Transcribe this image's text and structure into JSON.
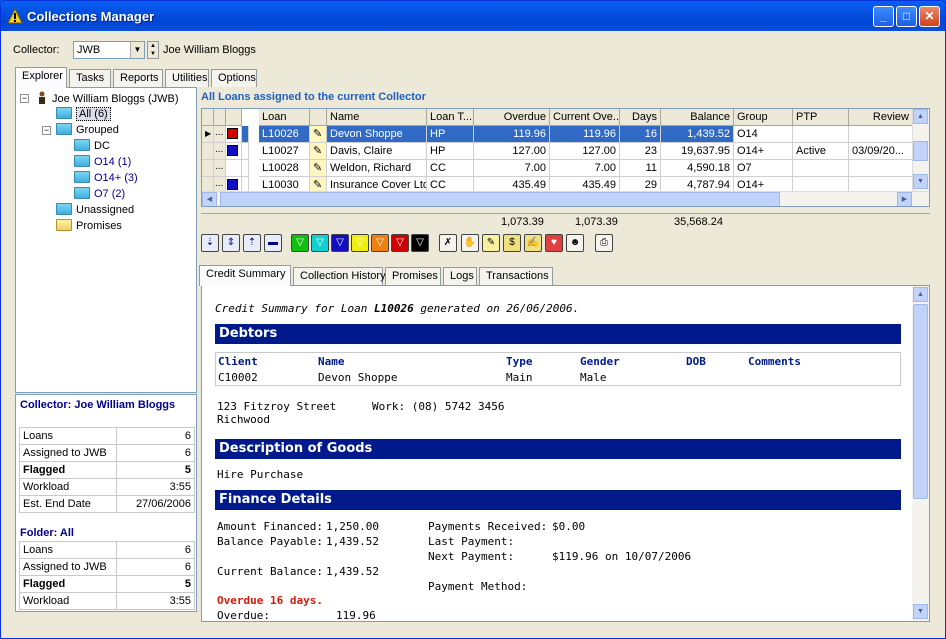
{
  "window": {
    "title": "Collections Manager"
  },
  "collector": {
    "label": "Collector:",
    "code": "JWB",
    "name": "Joe William Bloggs"
  },
  "main_tabs": [
    "Explorer",
    "Tasks",
    "Reports",
    "Utilities",
    "Options"
  ],
  "tree": {
    "root": "Joe William Bloggs (JWB)",
    "all": "All (6)",
    "grouped": "Grouped",
    "groups": [
      "DC",
      "O14 (1)",
      "O14+ (3)",
      "O7 (2)"
    ],
    "unassigned": "Unassigned",
    "promises": "Promises"
  },
  "stats": {
    "collector_title": "Collector: Joe William Bloggs",
    "collector_rows": [
      {
        "label": "Loans",
        "value": "6",
        "bold": false
      },
      {
        "label": "Assigned to JWB",
        "value": "6",
        "bold": false
      },
      {
        "label": "Flagged",
        "value": "5",
        "bold": true
      },
      {
        "label": "Workload",
        "value": "3:55",
        "bold": false
      },
      {
        "label": "Est. End Date",
        "value": "27/06/2006",
        "bold": false
      }
    ],
    "folder_title": "Folder: All",
    "folder_rows": [
      {
        "label": "Loans",
        "value": "6",
        "bold": false
      },
      {
        "label": "Assigned to JWB",
        "value": "6",
        "bold": false
      },
      {
        "label": "Flagged",
        "value": "5",
        "bold": true
      },
      {
        "label": "Workload",
        "value": "3:55",
        "bold": false
      }
    ]
  },
  "grid": {
    "title": "All Loans assigned to the current Collector",
    "columns": [
      "Loan",
      "Name",
      "Loan T...",
      "Overdue",
      "Current Ove...",
      "Days",
      "Balance",
      "Group",
      "PTP",
      "Review"
    ],
    "rows": [
      {
        "loan": "L10026",
        "name": "Devon Shoppe",
        "type": "HP",
        "overdue": "119.96",
        "current": "119.96",
        "days": "16",
        "balance": "1,439.52",
        "group": "O14",
        "ptp": "",
        "review": "",
        "flag": "#d00000",
        "selected": true
      },
      {
        "loan": "L10027",
        "name": "Davis, Claire",
        "type": "HP",
        "overdue": "127.00",
        "current": "127.00",
        "days": "23",
        "balance": "19,637.95",
        "group": "O14+",
        "ptp": "Active",
        "review": "03/09/20...",
        "flag": "#1010c0",
        "selected": false
      },
      {
        "loan": "L10028",
        "name": "Weldon, Richard",
        "type": "CC",
        "overdue": "7.00",
        "current": "7.00",
        "days": "11",
        "balance": "4,590.18",
        "group": "O7",
        "ptp": "",
        "review": "",
        "flag": "",
        "selected": false
      },
      {
        "loan": "L10030",
        "name": "Insurance Cover Ltd",
        "type": "CC",
        "overdue": "435.49",
        "current": "435.49",
        "days": "29",
        "balance": "4,787.94",
        "group": "O14+",
        "ptp": "",
        "review": "",
        "flag": "#1010c0",
        "selected": false
      }
    ],
    "row_marker": "...",
    "totals": {
      "overdue": "1,073.39",
      "current": "1,073.39",
      "balance": "35,568.24"
    }
  },
  "toolbar_flags": [
    "#10c010",
    "#10d0d0",
    "#1010c0",
    "#f0f010",
    "#f08010",
    "#d00000",
    "#000000"
  ],
  "detail_tabs": [
    "Credit Summary",
    "Collection History",
    "Promises",
    "Logs",
    "Transactions"
  ],
  "summary": {
    "intro_pre": "Credit Summary for Loan ",
    "intro_loan": "L10026",
    "intro_post": " generated on 26/06/2006.",
    "debtors_head": "Debtors",
    "debtor_cols": [
      "Client",
      "Name",
      "Type",
      "Gender",
      "DOB",
      "Comments"
    ],
    "debtor_row": [
      "C10002",
      "Devon Shoppe",
      "Main",
      "Male",
      "",
      ""
    ],
    "address1": "123 Fitzroy Street",
    "address2": "Richwood",
    "work": "Work: (08) 5742 3456",
    "goods_head": "Description of Goods",
    "goods": "Hire Purchase",
    "finance_head": "Finance Details",
    "amount_financed_label": "Amount Financed:",
    "amount_financed": "1,250.00",
    "balance_payable_label": "Balance Payable:",
    "balance_payable": "1,439.52",
    "current_balance_label": "Current Balance:",
    "current_balance": "1,439.52",
    "payments_received_label": "Payments Received:",
    "payments_received": "$0.00",
    "last_payment_label": "Last Payment:",
    "next_payment_label": "Next Payment:",
    "next_payment": "$119.96 on 10/07/2006",
    "payment_method_label": "Payment Method:",
    "overdue_days": "Overdue 16 days.",
    "overdue_label": "Overdue:",
    "overdue_value": "119.96"
  }
}
